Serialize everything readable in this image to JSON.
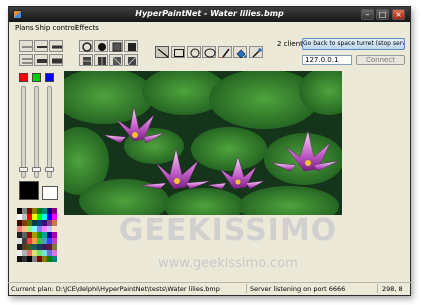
{
  "window": {
    "title": "HyperPaintNet - Water lilies.bmp"
  },
  "menu": {
    "items": [
      "Plans",
      "Ship control",
      "Effects"
    ]
  },
  "network": {
    "clients_label": "2 clients",
    "go_back_label": "Go back to space turret (stop server)",
    "ip_value": "127.0.0.1",
    "connect_label": "Connect"
  },
  "colors": {
    "primary_swatches": [
      "#ff0000",
      "#00cc00",
      "#0000ff"
    ],
    "foreground": "#000000",
    "background": "#ffffff",
    "accent_button": "#bcd6f0"
  },
  "status": {
    "plan": "Current plan: D:\\JCE\\delphi\\HyperPaintNet\\tests\\Water lilies.bmp",
    "server": "Server listening on port 6666",
    "coords": "298, 8"
  },
  "watermark": {
    "brand": "GEEKISSIMO",
    "url": "www.geekissimo.com"
  }
}
